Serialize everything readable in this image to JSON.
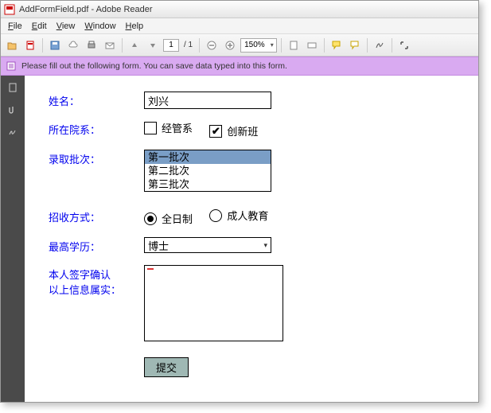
{
  "window": {
    "title": "AddFormField.pdf - Adobe Reader"
  },
  "menu": {
    "file": "File",
    "edit": "Edit",
    "view": "View",
    "window": "Window",
    "help": "Help"
  },
  "toolbar": {
    "page_current": "1",
    "page_total": "/ 1",
    "zoom": "150%"
  },
  "notice": {
    "text": "Please fill out the following form. You can save data typed into this form."
  },
  "form": {
    "name_label": "姓名：",
    "name_value": "刘兴",
    "dept_label": "所在院系：",
    "dept_opt1": "经管系",
    "dept_opt2": "创新班",
    "batch_label": "录取批次：",
    "batch_opts": [
      "第一批次",
      "第二批次",
      "第三批次"
    ],
    "mode_label": "招收方式：",
    "mode_opt1": "全日制",
    "mode_opt2": "成人教育",
    "edu_label": "最高学历：",
    "edu_value": "博士",
    "sign_label1": "本人签字确认",
    "sign_label2": "以上信息属实：",
    "submit": "提交"
  }
}
